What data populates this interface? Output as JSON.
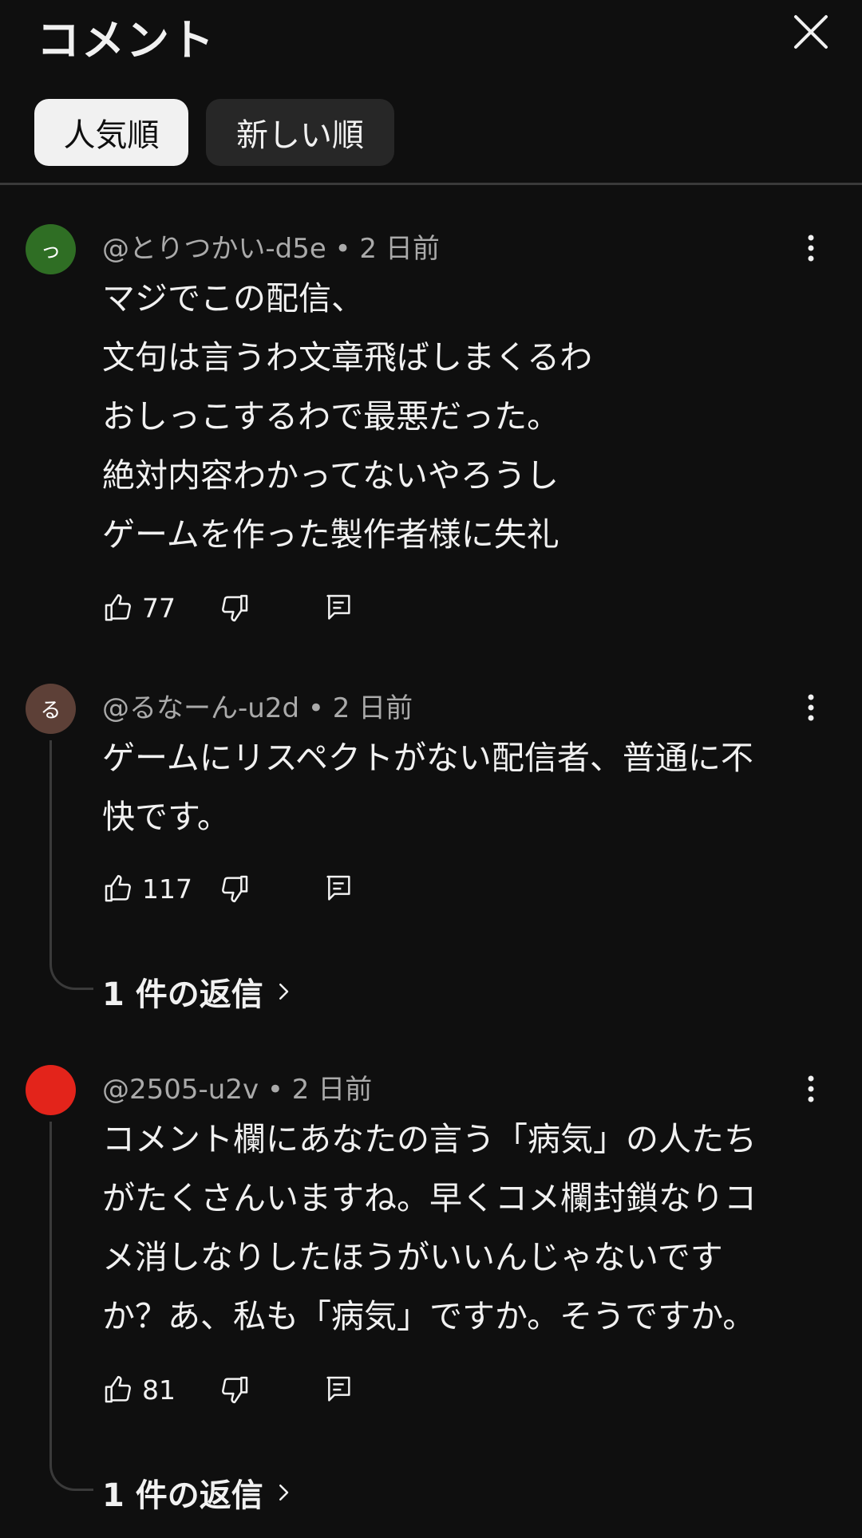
{
  "header": {
    "title": "コメント",
    "close_icon": "close-icon"
  },
  "sort_chips": [
    {
      "label": "人気順",
      "active": true
    },
    {
      "label": "新しい順",
      "active": false
    }
  ],
  "comments": [
    {
      "avatar": {
        "initial": "っ",
        "color": "#2f6e24"
      },
      "author": "@とりつかい-d5e",
      "time": "2 日前",
      "lines": [
        "マジでこの配信、",
        "文句は言うわ文章飛ばしまくるわ",
        "おしっこするわで最悪だった。",
        "絶対内容わかってないやろうし",
        "ゲームを作った製作者様に失礼"
      ],
      "likes": "77",
      "replies": ""
    },
    {
      "avatar": {
        "initial": "る",
        "color": "#5d4037"
      },
      "author": "@るなーん-u2d",
      "time": "2 日前",
      "lines": [
        "ゲームにリスペクトがない配信者、普通に不",
        "快です。"
      ],
      "likes": "117",
      "replies": "1 件の返信"
    },
    {
      "avatar": {
        "initial": "",
        "color": "#e3241b"
      },
      "author": "@2505-u2v",
      "time": "2 日前",
      "lines": [
        "コメント欄にあなたの言う「病気」の人たち",
        "がたくさんいますね。早くコメ欄封鎖なりコ",
        "メ消しなりしたほうがいいんじゃないです",
        "か？あ、私も「病気」ですか。そうですか。"
      ],
      "likes": "81",
      "replies": "1 件の返信"
    }
  ],
  "icons": [
    "like-icon",
    "dislike-icon",
    "reply-icon",
    "more-vert-icon",
    "chevron-right-icon"
  ],
  "colors": {
    "background": "#0f0f0f",
    "text": "#f1f1f1",
    "secondary_text": "#aaaaaa",
    "chip_active_bg": "#f1f1f1",
    "chip_inactive_bg": "#272727"
  }
}
